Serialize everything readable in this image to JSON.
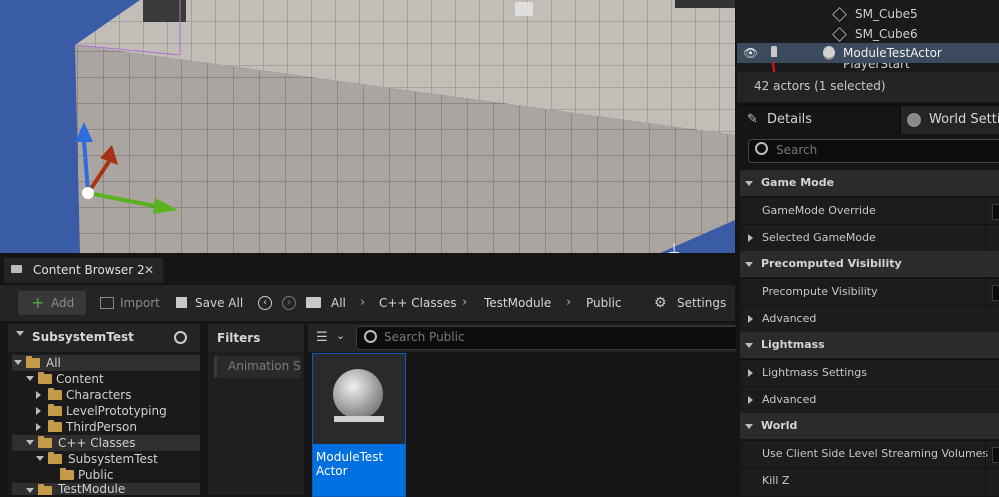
{
  "outliner": {
    "items": [
      {
        "label": "SM_Cube5"
      },
      {
        "label": "SM_Cube6"
      },
      {
        "label": "ModuleTestActor"
      },
      {
        "label": "PlayerStart"
      }
    ],
    "status": "42 actors (1 selected)"
  },
  "details": {
    "tabs": [
      {
        "label": "Details"
      },
      {
        "label": "World Settings"
      }
    ],
    "search_placeholder": "Search",
    "sections": [
      {
        "title": "Game Mode",
        "rows": [
          "GameMode Override",
          "Selected GameMode"
        ]
      },
      {
        "title": "Precomputed Visibility",
        "rows": [
          "Precompute Visibility",
          "Advanced"
        ]
      },
      {
        "title": "Lightmass",
        "rows": [
          "Lightmass Settings",
          "Advanced"
        ]
      },
      {
        "title": "World",
        "rows": [
          "Use Client Side Level Streaming Volumes",
          "Kill Z"
        ]
      }
    ]
  },
  "content_browser": {
    "tab_label": "Content Browser 2",
    "toolbar": {
      "add_label": "Add",
      "import_label": "Import",
      "save_all_label": "Save All",
      "settings_label": "Settings"
    },
    "breadcrumbs": [
      "All",
      "C++ Classes",
      "TestModule",
      "Public"
    ],
    "tree_header": "SubsystemTest",
    "tree": [
      {
        "label": "All"
      },
      {
        "label": "Content"
      },
      {
        "label": "Characters"
      },
      {
        "label": "LevelPrototyping"
      },
      {
        "label": "ThirdPerson"
      },
      {
        "label": "C++ Classes"
      },
      {
        "label": "SubsystemTest"
      },
      {
        "label": "Public"
      },
      {
        "label": "TestModule"
      }
    ],
    "filters_label": "Filters",
    "filter_chip": "Animation S",
    "search_placeholder": "Search Public",
    "asset": {
      "line1": "ModuleTest",
      "line2": "Actor"
    }
  },
  "colors": {
    "accent_blue": "#0070e0",
    "selection": "#3c4a5e",
    "folder": "#c59a48",
    "annotation_red": "#e0141e"
  },
  "icons": [
    "eye-icon",
    "pin-icon",
    "actor-icon",
    "cube-icon",
    "pencil-icon",
    "globe-icon",
    "search-icon",
    "close-icon",
    "plus-icon",
    "import-icon",
    "save-icon",
    "back-icon",
    "forward-icon",
    "folder-icon",
    "gear-icon",
    "filter-icon",
    "chevron-icon",
    "sphere-icon",
    "cpp-class-icon"
  ]
}
